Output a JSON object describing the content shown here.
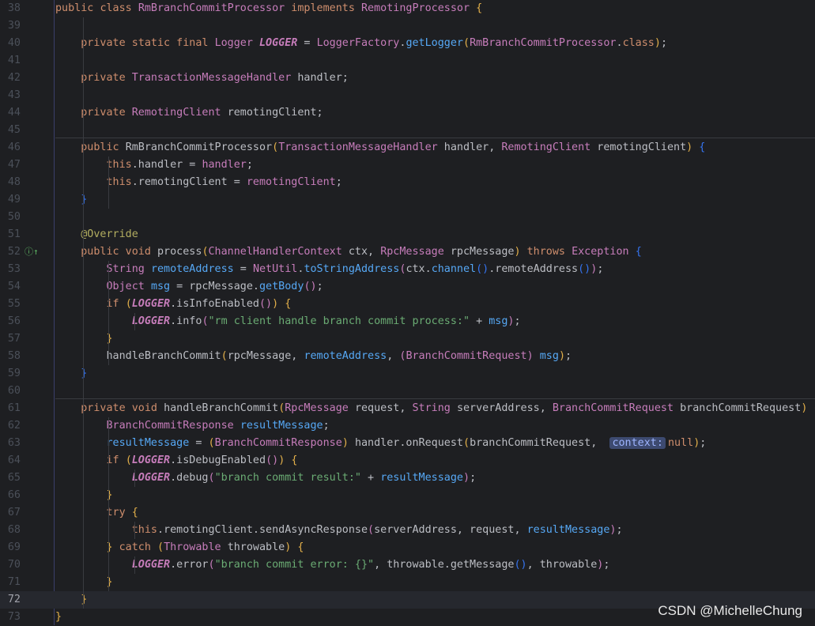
{
  "editor": {
    "lines": [
      {
        "n": "38",
        "segs": [
          [
            "kw",
            "public "
          ],
          [
            "kw",
            "class "
          ],
          [
            "cls",
            "RmBranchCommitProcessor "
          ],
          [
            "kw",
            "implements "
          ],
          [
            "cls",
            "RemotingProcessor "
          ],
          [
            "br1",
            "{"
          ]
        ]
      },
      {
        "n": "39",
        "segs": []
      },
      {
        "n": "40",
        "segs": [
          [
            "",
            "    "
          ],
          [
            "kw",
            "private static final "
          ],
          [
            "cls",
            "Logger "
          ],
          [
            "fld",
            "LOGGER"
          ],
          [
            "",
            " = "
          ],
          [
            "cls",
            "LoggerFactory"
          ],
          [
            "",
            "."
          ],
          [
            "met",
            "getLogger"
          ],
          [
            "br1",
            "("
          ],
          [
            "cls",
            "RmBranchCommitProcessor"
          ],
          [
            "",
            "."
          ],
          [
            "kw",
            "class"
          ],
          [
            "br1",
            ")"
          ],
          [
            "",
            ";"
          ]
        ]
      },
      {
        "n": "41",
        "segs": []
      },
      {
        "n": "42",
        "segs": [
          [
            "",
            "    "
          ],
          [
            "kw",
            "private "
          ],
          [
            "cls",
            "TransactionMessageHandler "
          ],
          [
            "",
            "handler;"
          ]
        ]
      },
      {
        "n": "43",
        "segs": []
      },
      {
        "n": "44",
        "segs": [
          [
            "",
            "    "
          ],
          [
            "kw",
            "private "
          ],
          [
            "cls",
            "RemotingClient "
          ],
          [
            "",
            "remotingClient;"
          ]
        ]
      },
      {
        "n": "45",
        "segs": []
      },
      {
        "n": "46",
        "segs": [
          [
            "",
            "    "
          ],
          [
            "kw",
            "public "
          ],
          [
            "",
            "RmBranchCommitProcessor"
          ],
          [
            "br1",
            "("
          ],
          [
            "cls",
            "TransactionMessageHandler "
          ],
          [
            "",
            "handler, "
          ],
          [
            "cls",
            "RemotingClient "
          ],
          [
            "",
            "remotingClient"
          ],
          [
            "br1",
            ") "
          ],
          [
            "br3",
            "{"
          ]
        ]
      },
      {
        "n": "47",
        "segs": [
          [
            "",
            "        "
          ],
          [
            "kw",
            "this"
          ],
          [
            "",
            ".handler = "
          ],
          [
            "var",
            "handler"
          ],
          [
            "",
            ";"
          ]
        ]
      },
      {
        "n": "48",
        "segs": [
          [
            "",
            "        "
          ],
          [
            "kw",
            "this"
          ],
          [
            "",
            ".remotingClient = "
          ],
          [
            "var",
            "remotingClient"
          ],
          [
            "",
            ";"
          ]
        ]
      },
      {
        "n": "49",
        "segs": [
          [
            "",
            "    "
          ],
          [
            "br3",
            "}"
          ]
        ]
      },
      {
        "n": "50",
        "segs": []
      },
      {
        "n": "51",
        "segs": [
          [
            "",
            "    "
          ],
          [
            "ann",
            "@Override"
          ]
        ]
      },
      {
        "n": "52",
        "segs": [
          [
            "",
            "    "
          ],
          [
            "kw",
            "public void "
          ],
          [
            "",
            "process"
          ],
          [
            "br1",
            "("
          ],
          [
            "cls",
            "ChannelHandlerContext "
          ],
          [
            "",
            "ctx, "
          ],
          [
            "cls",
            "RpcMessage "
          ],
          [
            "",
            "rpcMessage"
          ],
          [
            "br1",
            ") "
          ],
          [
            "kw",
            "throws "
          ],
          [
            "cls",
            "Exception "
          ],
          [
            "br3",
            "{"
          ]
        ],
        "gutter": "ⓘ↑"
      },
      {
        "n": "53",
        "segs": [
          [
            "",
            "        "
          ],
          [
            "cls",
            "String "
          ],
          [
            "met",
            "remoteAddress"
          ],
          [
            "",
            " = "
          ],
          [
            "cls",
            "NetUtil"
          ],
          [
            "",
            "."
          ],
          [
            "met",
            "toStringAddress"
          ],
          [
            "br2",
            "("
          ],
          [
            "",
            "ctx."
          ],
          [
            "met",
            "channel"
          ],
          [
            "br3",
            "()"
          ],
          [
            "",
            ".remoteAddress"
          ],
          [
            "br3",
            "()"
          ],
          [
            "br2",
            ")"
          ],
          [
            "",
            ";"
          ]
        ]
      },
      {
        "n": "54",
        "segs": [
          [
            "",
            "        "
          ],
          [
            "cls",
            "Object "
          ],
          [
            "met",
            "msg"
          ],
          [
            "",
            " = rpcMessage."
          ],
          [
            "met",
            "getBody"
          ],
          [
            "br2",
            "()"
          ],
          [
            "",
            ";"
          ]
        ]
      },
      {
        "n": "55",
        "segs": [
          [
            "",
            "        "
          ],
          [
            "kw",
            "if "
          ],
          [
            "br1",
            "("
          ],
          [
            "fld",
            "LOGGER"
          ],
          [
            "",
            ".isInfoEnabled"
          ],
          [
            "br2",
            "()"
          ],
          [
            "br1",
            ") "
          ],
          [
            "br1",
            "{"
          ]
        ]
      },
      {
        "n": "56",
        "segs": [
          [
            "",
            "            "
          ],
          [
            "fld",
            "LOGGER"
          ],
          [
            "",
            ".info"
          ],
          [
            "br2",
            "("
          ],
          [
            "str",
            "\"rm client handle branch commit process:\""
          ],
          [
            "",
            " + "
          ],
          [
            "met",
            "msg"
          ],
          [
            "br2",
            ")"
          ],
          [
            "",
            ";"
          ]
        ]
      },
      {
        "n": "57",
        "segs": [
          [
            "",
            "        "
          ],
          [
            "br1",
            "}"
          ]
        ]
      },
      {
        "n": "58",
        "segs": [
          [
            "",
            "        "
          ],
          [
            "",
            "handleBranchCommit"
          ],
          [
            "br1",
            "("
          ],
          [
            "",
            "rpcMessage, "
          ],
          [
            "met",
            "remoteAddress"
          ],
          [
            "",
            ", "
          ],
          [
            "br2",
            "("
          ],
          [
            "cls",
            "BranchCommitRequest"
          ],
          [
            "br2",
            ") "
          ],
          [
            "met",
            "msg"
          ],
          [
            "br1",
            ")"
          ],
          [
            "",
            ";"
          ]
        ]
      },
      {
        "n": "59",
        "segs": [
          [
            "",
            "    "
          ],
          [
            "br3",
            "}"
          ]
        ]
      },
      {
        "n": "60",
        "segs": []
      },
      {
        "n": "61",
        "segs": [
          [
            "",
            "    "
          ],
          [
            "kw",
            "private void "
          ],
          [
            "",
            "handleBranchCommit"
          ],
          [
            "br1",
            "("
          ],
          [
            "cls",
            "RpcMessage "
          ],
          [
            "",
            "request, "
          ],
          [
            "cls",
            "String "
          ],
          [
            "",
            "serverAddress, "
          ],
          [
            "cls",
            "BranchCommitRequest "
          ],
          [
            "",
            "branchCommitRequest"
          ],
          [
            "br1",
            ") "
          ],
          [
            "br1",
            "{"
          ]
        ]
      },
      {
        "n": "62",
        "segs": [
          [
            "",
            "        "
          ],
          [
            "cls",
            "BranchCommitResponse "
          ],
          [
            "met",
            "resultMessage"
          ],
          [
            "",
            ";"
          ]
        ]
      },
      {
        "n": "63",
        "segs": [
          [
            "",
            "        "
          ],
          [
            "met",
            "resultMessage"
          ],
          [
            "",
            " = "
          ],
          [
            "br1",
            "("
          ],
          [
            "cls",
            "BranchCommitResponse"
          ],
          [
            "br1",
            ") "
          ],
          [
            "",
            "handler.onRequest"
          ],
          [
            "br1",
            "("
          ],
          [
            "",
            "branchCommitRequest,  "
          ],
          [
            "hint",
            "context:"
          ],
          [
            "kw",
            "null"
          ],
          [
            "br1",
            ")"
          ],
          [
            "",
            ";"
          ]
        ]
      },
      {
        "n": "64",
        "segs": [
          [
            "",
            "        "
          ],
          [
            "kw",
            "if "
          ],
          [
            "br1",
            "("
          ],
          [
            "fld",
            "LOGGER"
          ],
          [
            "",
            ".isDebugEnabled"
          ],
          [
            "br2",
            "()"
          ],
          [
            "br1",
            ") "
          ],
          [
            "br1",
            "{"
          ]
        ]
      },
      {
        "n": "65",
        "segs": [
          [
            "",
            "            "
          ],
          [
            "fld",
            "LOGGER"
          ],
          [
            "",
            ".debug"
          ],
          [
            "br2",
            "("
          ],
          [
            "str",
            "\"branch commit result:\""
          ],
          [
            "",
            " + "
          ],
          [
            "met",
            "resultMessage"
          ],
          [
            "br2",
            ")"
          ],
          [
            "",
            ";"
          ]
        ]
      },
      {
        "n": "66",
        "segs": [
          [
            "",
            "        "
          ],
          [
            "br1",
            "}"
          ]
        ]
      },
      {
        "n": "67",
        "segs": [
          [
            "",
            "        "
          ],
          [
            "kw",
            "try "
          ],
          [
            "br1",
            "{"
          ]
        ]
      },
      {
        "n": "68",
        "segs": [
          [
            "",
            "            "
          ],
          [
            "kw",
            "this"
          ],
          [
            "",
            ".remotingClient.sendAsyncResponse"
          ],
          [
            "br2",
            "("
          ],
          [
            "",
            "serverAddress, request, "
          ],
          [
            "met",
            "resultMessage"
          ],
          [
            "br2",
            ")"
          ],
          [
            "",
            ";"
          ]
        ]
      },
      {
        "n": "69",
        "segs": [
          [
            "",
            "        "
          ],
          [
            "br1",
            "} "
          ],
          [
            "kw",
            "catch "
          ],
          [
            "br1",
            "("
          ],
          [
            "cls",
            "Throwable "
          ],
          [
            "",
            "throwable"
          ],
          [
            "br1",
            ") "
          ],
          [
            "br1",
            "{"
          ]
        ]
      },
      {
        "n": "70",
        "segs": [
          [
            "",
            "            "
          ],
          [
            "fld",
            "LOGGER"
          ],
          [
            "",
            ".error"
          ],
          [
            "br2",
            "("
          ],
          [
            "str",
            "\"branch commit error: {}\""
          ],
          [
            "",
            ", throwable.getMessage"
          ],
          [
            "br3",
            "()"
          ],
          [
            "",
            ", throwable"
          ],
          [
            "br2",
            ")"
          ],
          [
            "",
            ";"
          ]
        ]
      },
      {
        "n": "71",
        "segs": [
          [
            "",
            "        "
          ],
          [
            "br1",
            "}"
          ]
        ]
      },
      {
        "n": "72",
        "segs": [
          [
            "",
            "    "
          ],
          [
            "br1",
            "}"
          ]
        ],
        "current": true
      },
      {
        "n": "73",
        "segs": [
          [
            "br1",
            "}"
          ]
        ]
      }
    ]
  },
  "watermark": "CSDN @MichelleChung"
}
